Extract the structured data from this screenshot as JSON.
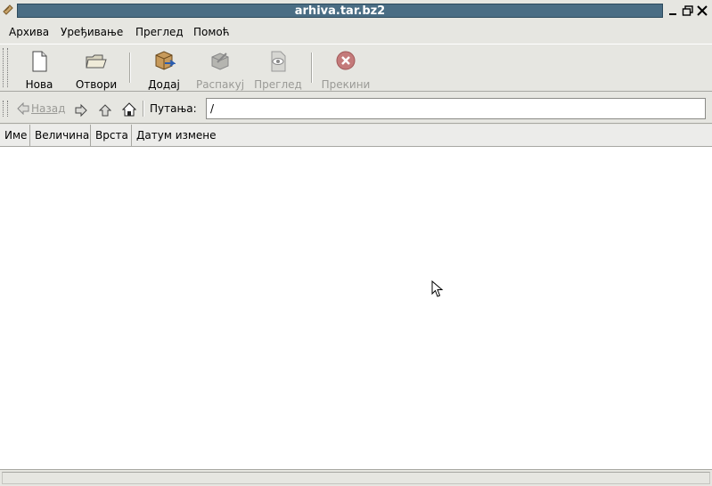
{
  "window": {
    "title": "arhiva.tar.bz2"
  },
  "menu": [
    {
      "label": "Архива"
    },
    {
      "label": "Уређивање"
    },
    {
      "label": "Преглед"
    },
    {
      "label": "Помоћ"
    }
  ],
  "toolbar": {
    "new": {
      "label": "Нова",
      "icon": "new-document-icon"
    },
    "open": {
      "label": "Отвори",
      "icon": "open-folder-icon"
    },
    "add": {
      "label": "Додај",
      "icon": "add-to-archive-icon"
    },
    "extract": {
      "label": "Распакуј",
      "icon": "extract-icon",
      "disabled": true
    },
    "view": {
      "label": "Преглед",
      "icon": "view-icon",
      "disabled": true
    },
    "stop": {
      "label": "Прекини",
      "icon": "stop-icon",
      "disabled": true
    }
  },
  "location": {
    "back_label": "Назад",
    "path_label": "Путања:",
    "path_value": "/"
  },
  "columns": [
    "Име",
    "Величина",
    "Врста",
    "Датум измене"
  ],
  "files": [],
  "colors": {
    "title_bar": "#4a6d84",
    "window_bg": "#e6e6e1",
    "list_bg": "#ffffff"
  }
}
